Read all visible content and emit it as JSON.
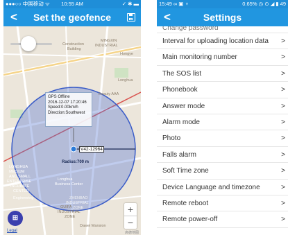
{
  "left": {
    "status": {
      "carrier": "●●●○○ 中国移动 ᯤ",
      "time": "10:55 AM",
      "battery": "✓ ✱ ▬"
    },
    "nav": {
      "back": "<",
      "title": "Set the geofence"
    },
    "popup": {
      "line1": "GPS Offline",
      "line2": "2016-12-07 17:20:46",
      "line3": "Speed:0.00km/h",
      "line4": "Direction:Southwest"
    },
    "device_tag": "V42-12964",
    "radius": "Radius:700 m",
    "map_labels": {
      "l1": "MINGXIN",
      "l2": "INDUSTRIAL",
      "l3": "Construction",
      "l4": "Building",
      "l5": "Hongye",
      "l6": "Beauty AAA",
      "l7": "Longhua",
      "l8": "LONGHUA",
      "l9": "MEDIUM",
      "l10": "AND SMALL",
      "l11": "ENTERPRISE",
      "l12": "INCUBATE",
      "l13": "CENTER",
      "l14": "ZHENBAO",
      "l15": "INDUSTRIAL",
      "l16": "ZONE",
      "l17": "GUIFA",
      "l18": "INDUSTRIAL",
      "l19": "ZONE",
      "l20": "Dawei Mansion",
      "l21": "Longhua",
      "l22": "Business Center",
      "l23": "Engineering"
    },
    "zoom": {
      "in": "+",
      "out": "−"
    },
    "fab": "⊞",
    "legal": "Legal",
    "copyright": "高德地图"
  },
  "right": {
    "status": {
      "left": "15:49 ∞ ▣ ♆",
      "right": "0.65% ◷ ⊙ ◢ ▮ 49"
    },
    "nav": {
      "back": "<",
      "title": "Settings"
    },
    "cut_item": "Change password",
    "items": [
      "Interval for uploading location data",
      "Main monitoring number",
      "The SOS list",
      "Phonebook",
      "Answer mode",
      "Alarm mode",
      "Photo",
      "Falls alarm",
      "Soft Time zone",
      "Device Language and timezone",
      "Remote reboot",
      "Remote power-off"
    ],
    "chevron": ">"
  }
}
